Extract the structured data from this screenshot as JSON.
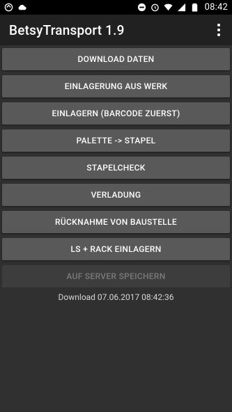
{
  "statusbar": {
    "left_icons": [
      "sync-icon",
      "cloud-icon"
    ],
    "right_icons": [
      "dnd-icon",
      "alarm-icon",
      "wifi-icon",
      "signal-icon",
      "battery-icon"
    ],
    "time": "08:42"
  },
  "appbar": {
    "title": "BetsyTransport 1.9",
    "overflow_icon": "more-vert-icon"
  },
  "buttons": [
    {
      "label": "DOWNLOAD DATEN",
      "enabled": true
    },
    {
      "label": "EINLAGERUNG AUS WERK",
      "enabled": true
    },
    {
      "label": "EINLAGERN (BARCODE ZUERST)",
      "enabled": true
    },
    {
      "label": "PALETTE -> STAPEL",
      "enabled": true
    },
    {
      "label": "STAPELCHECK",
      "enabled": true
    },
    {
      "label": "VERLADUNG",
      "enabled": true
    },
    {
      "label": "RÜCKNAHME VON BAUSTELLE",
      "enabled": true
    },
    {
      "label": "LS + RACK EINLAGERN",
      "enabled": true
    },
    {
      "label": "AUF SERVER SPEICHERN",
      "enabled": false
    }
  ],
  "status_text": "Download 07.06.2017 08:42:36",
  "colors": {
    "background": "#303030",
    "appbar": "#212121",
    "button": "#595959",
    "button_disabled": "#3d3d3d",
    "text_disabled": "#7b7b7b"
  }
}
